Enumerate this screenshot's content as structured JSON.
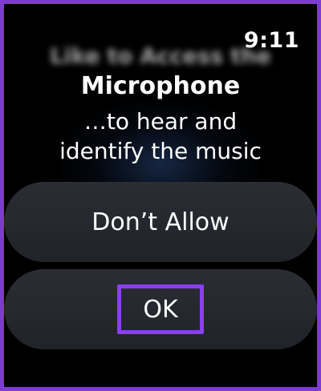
{
  "status_bar": {
    "time": "9:11"
  },
  "alert": {
    "blurred_header": "Like to Access the",
    "title": "Microphone",
    "subtitle_line1": "…to hear and",
    "subtitle_line2": "identify the music"
  },
  "buttons": {
    "deny_label": "Don’t Allow",
    "ok_label": "OK"
  },
  "colors": {
    "frame_border": "#7d3bd0",
    "highlight_box": "#8a3ff0",
    "button_bg": "#24272c",
    "screen_bg": "#000000"
  }
}
